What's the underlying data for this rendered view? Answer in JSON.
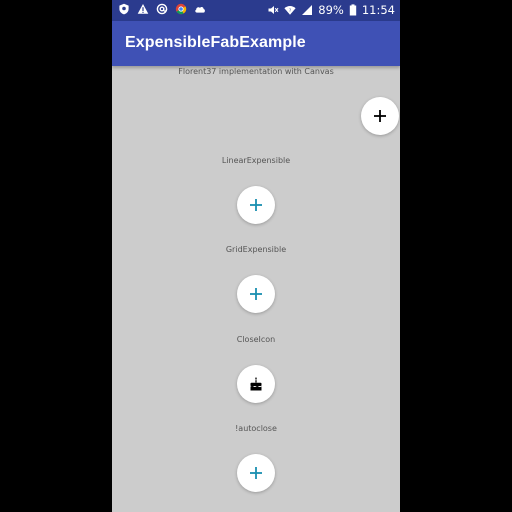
{
  "status_bar": {
    "battery_percent": "89%",
    "time": "11:54",
    "left_icons": [
      "shield-icon",
      "warning-icon",
      "at-sign-icon",
      "chrome-icon",
      "cloud-icon"
    ],
    "right_icons": [
      "mute-icon",
      "wifi-icon",
      "signal-icon",
      "battery-icon"
    ]
  },
  "app_bar": {
    "title": "ExpensibleFabExample"
  },
  "sections": [
    {
      "label": "Florent37 implementation with Canvas",
      "icon": "plus-icon",
      "icon_color": "#000000"
    },
    {
      "label": "LinearExpensible",
      "icon": "plus-icon",
      "icon_color": "#1a8fb0"
    },
    {
      "label": "GridExpensible",
      "icon": "plus-icon",
      "icon_color": "#1a8fb0"
    },
    {
      "label": "CloseIcon",
      "icon": "cake-icon",
      "icon_color": "#000000"
    },
    {
      "label": "!autoclose",
      "icon": "plus-icon",
      "icon_color": "#1a8fb0"
    }
  ],
  "colors": {
    "status_bar": "#2b3b8e",
    "app_bar": "#3f51b5",
    "background": "#cccccc",
    "accent": "#1a8fb0"
  }
}
